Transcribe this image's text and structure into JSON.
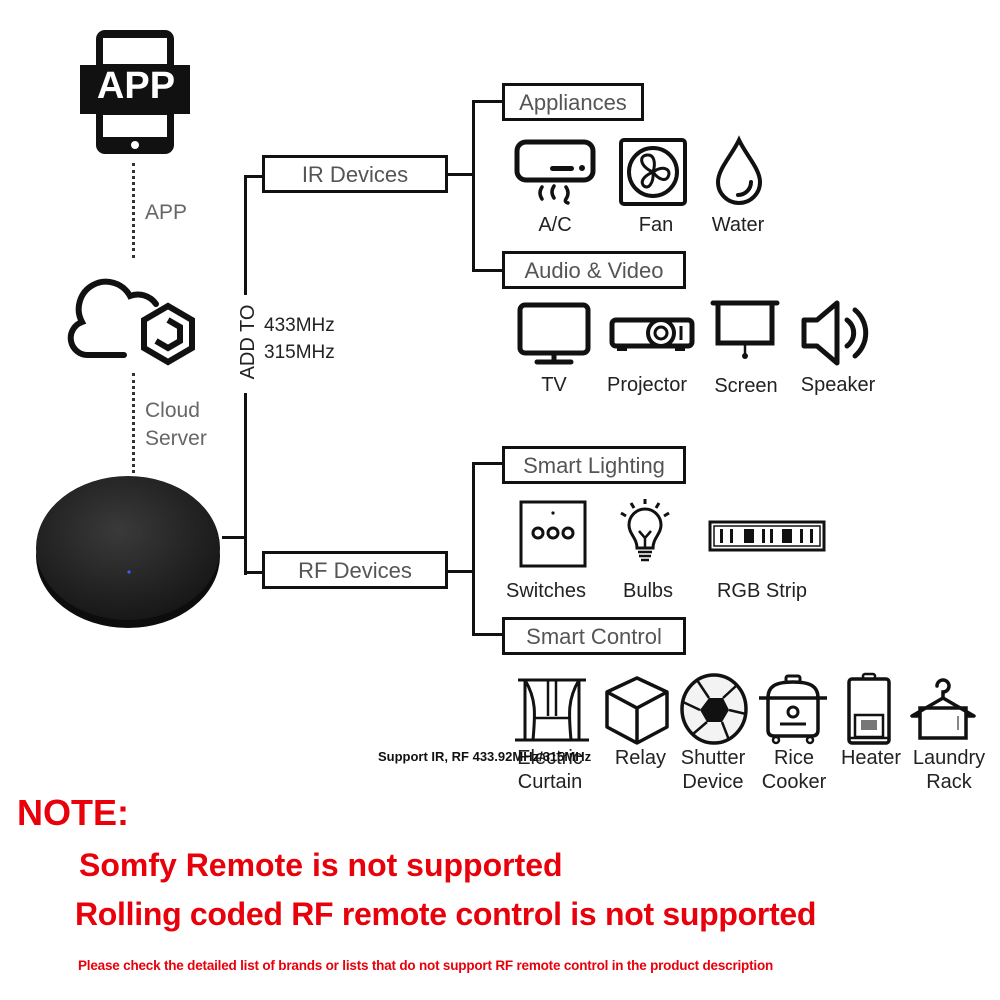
{
  "left_column": {
    "app_icon_text": "APP",
    "app_label": "APP",
    "cloud_label_line1": "Cloud",
    "cloud_label_line2": "Server"
  },
  "trunk": {
    "vertical_label": "ADD TO",
    "freq1": "433MHz",
    "freq2": "315MHz"
  },
  "ir": {
    "label": "IR Devices",
    "groups": [
      {
        "label": "Appliances",
        "items": [
          {
            "icon": "air-conditioner-icon",
            "label": "A/C"
          },
          {
            "icon": "fan-icon",
            "label": "Fan"
          },
          {
            "icon": "water-drop-icon",
            "label": "Water"
          }
        ]
      },
      {
        "label": "Audio & Video",
        "items": [
          {
            "icon": "tv-icon",
            "label": "TV"
          },
          {
            "icon": "projector-icon",
            "label": "Projector"
          },
          {
            "icon": "projection-screen-icon",
            "label": "Screen"
          },
          {
            "icon": "speaker-icon",
            "label": "Speaker"
          }
        ]
      }
    ]
  },
  "rf": {
    "label": "RF Devices",
    "groups": [
      {
        "label": "Smart Lighting",
        "items": [
          {
            "icon": "wall-switch-icon",
            "label": "Switches"
          },
          {
            "icon": "light-bulb-icon",
            "label": "Bulbs"
          },
          {
            "icon": "led-strip-icon",
            "label": "RGB Strip"
          }
        ]
      },
      {
        "label": "Smart Control",
        "items": [
          {
            "icon": "curtain-icon",
            "label1": "Electric",
            "label2": "Curtain"
          },
          {
            "icon": "relay-cube-icon",
            "label1": "Relay",
            "label2": ""
          },
          {
            "icon": "shutter-icon",
            "label1": "Shutter",
            "label2": "Device"
          },
          {
            "icon": "rice-cooker-icon",
            "label1": "Rice",
            "label2": "Cooker"
          },
          {
            "icon": "water-heater-icon",
            "label1": "Heater",
            "label2": ""
          },
          {
            "icon": "laundry-rack-icon",
            "label1": "Laundry",
            "label2": "Rack"
          }
        ]
      }
    ]
  },
  "overlay_text": "Support IR, RF 433.92MHz/315MHz",
  "note": {
    "heading": "NOTE:",
    "line1": "Somfy Remote is not supported",
    "line2": "Rolling coded RF remote control is not supported",
    "footnote": "Please check the detailed list of brands or lists that do not support RF remote control in the product description",
    "color": "#e8000b"
  }
}
